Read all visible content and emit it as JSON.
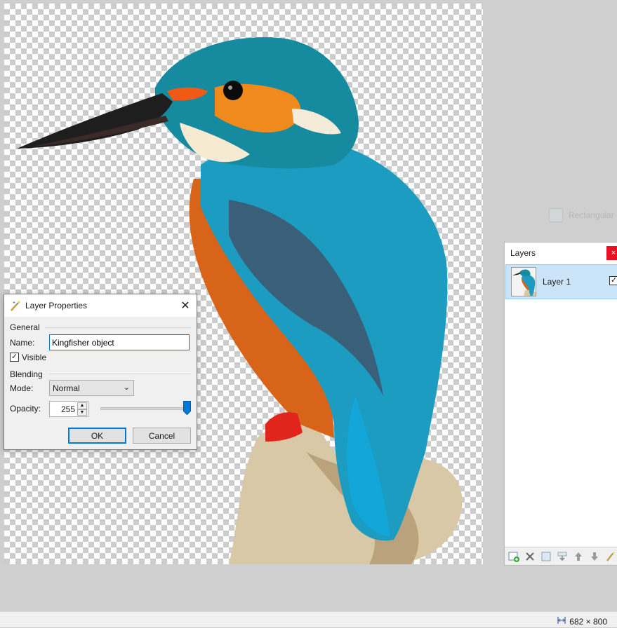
{
  "canvas": {
    "image_alt": "kingfisher"
  },
  "ghost_hint": {
    "text": "Rectangular"
  },
  "layers_panel": {
    "title": "Layers",
    "close_glyph": "×",
    "layers": [
      {
        "name": "Layer 1",
        "visible_glyph": "✓",
        "selected": true
      }
    ],
    "toolbar_icons": [
      "add-layer-icon",
      "delete-layer-icon",
      "duplicate-layer-icon",
      "merge-layer-down-icon",
      "move-layer-up-icon",
      "move-layer-down-icon",
      "layer-properties-icon"
    ]
  },
  "dialog": {
    "title": "Layer Properties",
    "close_glyph": "✕",
    "general_label": "General",
    "name_label": "Name:",
    "name_value": "Kingfisher object",
    "visible_label": "Visible",
    "visible_glyph": "✓",
    "blending_label": "Blending",
    "mode_label": "Mode:",
    "mode_value": "Normal",
    "mode_chevron": "⌄",
    "opacity_label": "Opacity:",
    "opacity_value": "255",
    "opacity_max": 255,
    "spin_up": "▲",
    "spin_down": "▼",
    "ok_label": "OK",
    "cancel_label": "Cancel"
  },
  "statusbar": {
    "image_size": "682 × 800"
  },
  "colors": {
    "accent": "#0078d7",
    "selection": "#cce4f7",
    "close_red": "#e81123"
  }
}
